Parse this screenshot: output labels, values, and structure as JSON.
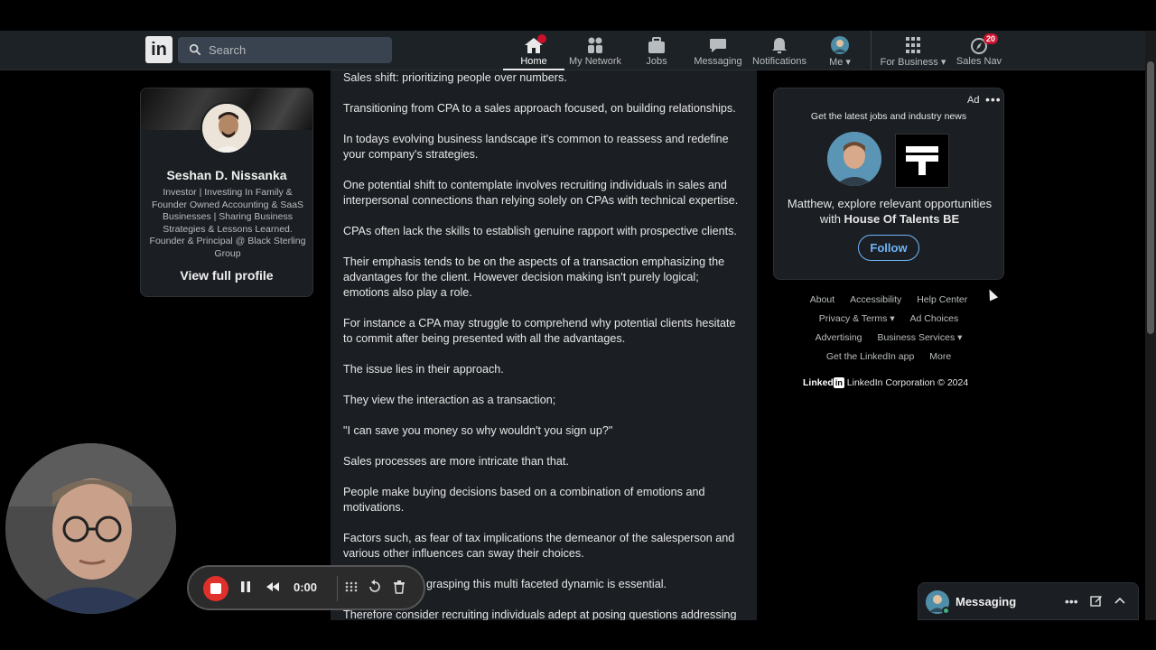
{
  "nav": {
    "logo": "in",
    "search_placeholder": "Search",
    "items": [
      {
        "label": "Home",
        "icon": "home-icon",
        "active": true
      },
      {
        "label": "My Network",
        "icon": "network-icon"
      },
      {
        "label": "Jobs",
        "icon": "jobs-icon"
      },
      {
        "label": "Messaging",
        "icon": "messaging-icon"
      },
      {
        "label": "Notifications",
        "icon": "bell-icon"
      },
      {
        "label": "Me",
        "icon": "avatar-icon"
      },
      {
        "label": "For Business",
        "icon": "grid-icon"
      },
      {
        "label": "Sales Nav",
        "icon": "compass-icon",
        "badge": "20"
      }
    ]
  },
  "profile": {
    "name": "Seshan D. Nissanka",
    "headline": "Investor | Investing In Family & Founder Owned Accounting & SaaS Businesses | Sharing Business Strategies & Lessons Learned. Founder & Principal @ Black Sterling Group",
    "view_profile": "View full profile"
  },
  "post": {
    "paragraphs": [
      "Sales shift: prioritizing people over numbers.",
      "Transitioning from CPA to a sales approach focused, on building relationships.",
      "In todays evolving business landscape it's common to reassess and redefine your company's strategies.",
      "One potential shift to contemplate involves recruiting individuals in sales and interpersonal connections than relying solely on CPAs with technical expertise.",
      "CPAs often lack the skills to establish genuine rapport with prospective clients.",
      "Their emphasis tends to be on the aspects of a transaction emphasizing the advantages for the client. However decision making isn't purely logical; emotions also play a role.",
      "For instance a CPA may struggle to comprehend why potential clients hesitate to commit after being presented with all the advantages.",
      "The issue lies in their approach.",
      "They view the interaction as a transaction;",
      "\"I can save you money so why wouldn't you sign up?\"",
      "Sales processes are more intricate than that.",
      "People make buying decisions based on a combination of emotions and motivations.",
      "Factors such, as fear of tax implications the demeanor of the salesperson and various other influences can sway their choices.",
      "grasping this multi faceted dynamic is essential.",
      "Therefore consider recruiting individuals adept at posing questions addressing"
    ]
  },
  "ad": {
    "label": "Ad",
    "more": "•••",
    "tagline": "Get the latest jobs and industry news",
    "text_prefix": "Matthew, explore relevant opportunities with ",
    "company": "House Of Talents BE",
    "follow": "Follow"
  },
  "footer": {
    "row1": [
      "About",
      "Accessibility",
      "Help Center"
    ],
    "row2": [
      "Privacy & Terms ▾",
      "Ad Choices"
    ],
    "row3": [
      "Advertising",
      "Business Services ▾"
    ],
    "row4": [
      "Get the LinkedIn app",
      "More"
    ],
    "brand_word": "Linked",
    "brand_in": "in",
    "copyright": "LinkedIn Corporation © 2024"
  },
  "recorder": {
    "timer": "0:00"
  },
  "messaging": {
    "title": "Messaging"
  },
  "colors": {
    "accent": "#70b5f9",
    "record": "#e0302c",
    "badge": "#cb112d",
    "online": "#44b37f"
  }
}
